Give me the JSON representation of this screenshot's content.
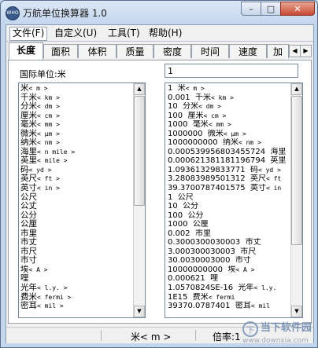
{
  "window": {
    "title": "万航单位换算器 1.0",
    "icon_text": "WHO",
    "controls": {
      "minimize": "–",
      "maximize": "□",
      "close": "✕"
    }
  },
  "menu": [
    {
      "label": "文件(F)"
    },
    {
      "label": "自定义(U)"
    },
    {
      "label": "工具(T)"
    },
    {
      "label": "帮助(H)"
    }
  ],
  "tabs": [
    {
      "label": "长度",
      "selected": true
    },
    {
      "label": "面积"
    },
    {
      "label": "体积"
    },
    {
      "label": "质量"
    },
    {
      "label": "密度"
    },
    {
      "label": "时间"
    },
    {
      "label": "速度"
    },
    {
      "label": "加"
    }
  ],
  "tab_arrows": {
    "left": "◀",
    "right": "▶"
  },
  "si_label": "国际单位:米",
  "input_value": "1",
  "unit_list": [
    {
      "name": "米",
      "unit": "< m >"
    },
    {
      "name": "千米",
      "unit": "< km >"
    },
    {
      "name": "分米",
      "unit": "< dm >"
    },
    {
      "name": "厘米",
      "unit": "< cm >"
    },
    {
      "name": "毫米",
      "unit": "< mm >"
    },
    {
      "name": "微米",
      "unit": "< μm >"
    },
    {
      "name": "纳米",
      "unit": "< nm >"
    },
    {
      "name": "海里",
      "unit": "< n mile >"
    },
    {
      "name": "英里",
      "unit": "< mile >"
    },
    {
      "name": "码",
      "unit": "< yd >"
    },
    {
      "name": "英尺",
      "unit": "< ft >"
    },
    {
      "name": "英寸",
      "unit": "< in >"
    },
    {
      "name": "公尺",
      "unit": ""
    },
    {
      "name": "公丈",
      "unit": ""
    },
    {
      "name": "公分",
      "unit": ""
    },
    {
      "name": "公厘",
      "unit": ""
    },
    {
      "name": "市里",
      "unit": ""
    },
    {
      "name": "市丈",
      "unit": ""
    },
    {
      "name": "市尺",
      "unit": ""
    },
    {
      "name": "市寸",
      "unit": ""
    },
    {
      "name": "埃",
      "unit": "< A >"
    },
    {
      "name": "哩",
      "unit": ""
    },
    {
      "name": "光年",
      "unit": "< l.y. >"
    },
    {
      "name": "费米",
      "unit": "< fermi >"
    },
    {
      "name": "密耳",
      "unit": "< mil >"
    }
  ],
  "results": [
    {
      "value": "1",
      "name": "米",
      "unit": "< m >"
    },
    {
      "value": "0.001",
      "name": "千米",
      "unit": "< km >"
    },
    {
      "value": "10",
      "name": "分米",
      "unit": "< dm >"
    },
    {
      "value": "100",
      "name": "厘米",
      "unit": "< cm >"
    },
    {
      "value": "1000",
      "name": "毫米",
      "unit": "< mm >"
    },
    {
      "value": "1000000",
      "name": "微米",
      "unit": "< μm >"
    },
    {
      "value": "1000000000",
      "name": "纳米",
      "unit": "< nm >"
    },
    {
      "value": "0.000539956803455724",
      "name": "海里",
      "unit": ""
    },
    {
      "value": "0.000621381181196794",
      "name": "英里",
      "unit": ""
    },
    {
      "value": "1.09361329833771",
      "name": "码",
      "unit": "< yd >"
    },
    {
      "value": "3.28083989501312",
      "name": "英尺",
      "unit": "< ft"
    },
    {
      "value": "39.3700787401575",
      "name": "英寸",
      "unit": "< in"
    },
    {
      "value": "1",
      "name": "公尺",
      "unit": ""
    },
    {
      "value": "10",
      "name": "公分",
      "unit": ""
    },
    {
      "value": "100",
      "name": "公分",
      "unit": ""
    },
    {
      "value": "1000",
      "name": "公厘",
      "unit": ""
    },
    {
      "value": "0.002",
      "name": "市里",
      "unit": ""
    },
    {
      "value": "0.3000300030003",
      "name": "市丈",
      "unit": ""
    },
    {
      "value": "3.000300030003",
      "name": "市尺",
      "unit": ""
    },
    {
      "value": "30.0030003000",
      "name": "市寸",
      "unit": ""
    },
    {
      "value": "10000000000",
      "name": "埃",
      "unit": "< A >"
    },
    {
      "value": "0.000621",
      "name": "哩",
      "unit": ""
    },
    {
      "value": "1.0570824SE-16",
      "name": "光年",
      "unit": "< l.y."
    },
    {
      "value": "1E15",
      "name": "费米",
      "unit": "< fermi"
    },
    {
      "value": "39370.0787401",
      "name": "密耳",
      "unit": "< mil"
    }
  ],
  "status": {
    "current_unit": "米< m >",
    "multiplier": "倍率:1"
  },
  "watermark": {
    "brand": "当下软件园",
    "url": "www.downxia.com"
  }
}
